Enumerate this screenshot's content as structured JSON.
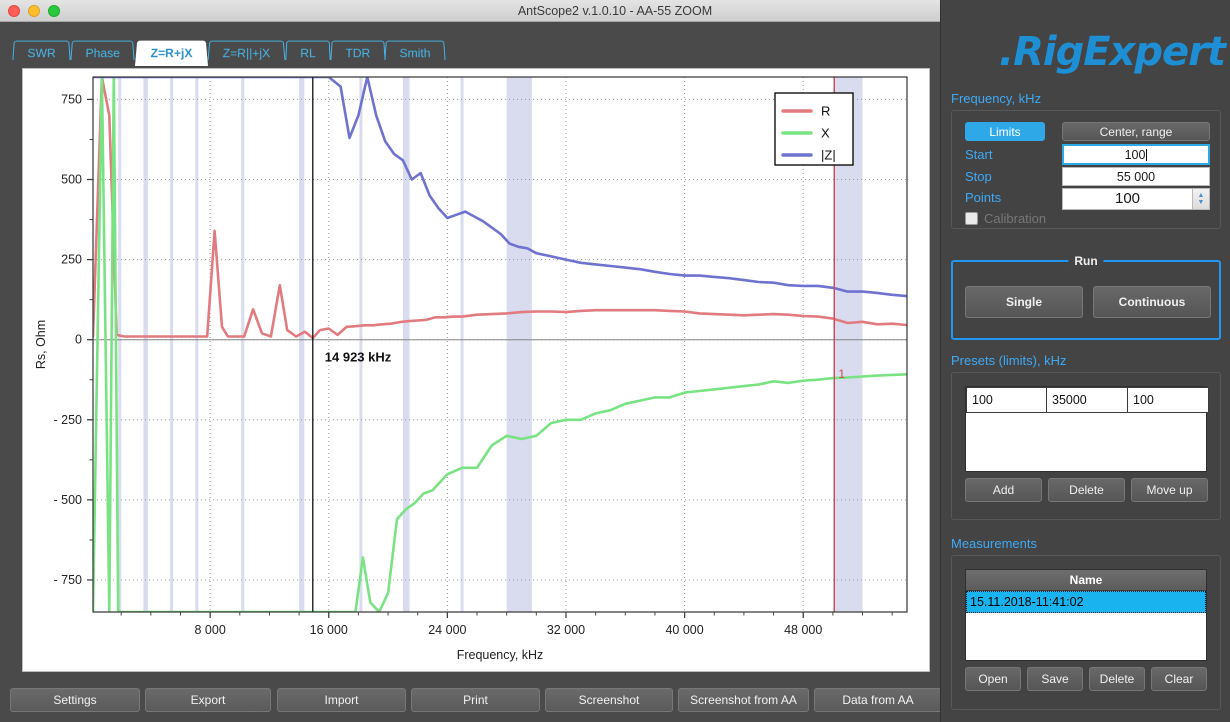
{
  "window": {
    "title": "AntScope2 v.1.0.10 - AA-55 ZOOM",
    "traffic_lights": [
      "close",
      "minimize",
      "zoom"
    ]
  },
  "tabs": [
    {
      "label": "SWR",
      "active": false
    },
    {
      "label": "Phase",
      "active": false
    },
    {
      "label": "Z=R+jX",
      "active": true
    },
    {
      "label": "Z=R||+jX",
      "active": false
    },
    {
      "label": "RL",
      "active": false
    },
    {
      "label": "TDR",
      "active": false
    },
    {
      "label": "Smith",
      "active": false
    }
  ],
  "bottom_toolbar": {
    "buttons": [
      {
        "label": "Settings",
        "x": 10,
        "w": 130
      },
      {
        "label": "Export",
        "x": 145,
        "w": 126
      },
      {
        "label": "Import",
        "x": 277,
        "w": 129
      },
      {
        "label": "Print",
        "x": 411,
        "w": 129
      },
      {
        "label": "Screenshot",
        "x": 545,
        "w": 128
      },
      {
        "label": "Screenshot from AA",
        "x": 678,
        "w": 131
      },
      {
        "label": "Data from AA",
        "x": 814,
        "w": 128
      }
    ]
  },
  "logo": {
    "text": ".RigExpert",
    "color": "#1e8fd5"
  },
  "right_panel": {
    "frequency": {
      "section_title": "Frequency, kHz",
      "mode_limits": "Limits",
      "mode_center_range": "Center, range",
      "start_label": "Start",
      "start_value": "100",
      "stop_label": "Stop",
      "stop_value": "55 000",
      "points_label": "Points",
      "points_value": "100",
      "calibration_label": "Calibration",
      "calibration_checked": false
    },
    "run": {
      "legend": "Run",
      "single": "Single",
      "continuous": "Continuous"
    },
    "presets": {
      "section_title": "Presets (limits), kHz",
      "rows": [
        [
          "100",
          "35000",
          "100"
        ]
      ],
      "buttons": [
        "Add",
        "Delete",
        "Move up"
      ]
    },
    "measurements": {
      "section_title": "Measurements",
      "column_header": "Name",
      "rows": [
        "15.11.2018-11:41:02"
      ],
      "selected_index": 0,
      "buttons": [
        "Open",
        "Save",
        "Delete",
        "Clear"
      ]
    }
  },
  "chart_data": {
    "type": "line",
    "title": "",
    "xlabel": "Frequency, kHz",
    "ylabel": "Rs, Ohm",
    "xlim": [
      100,
      55000
    ],
    "ylim": [
      -850,
      820
    ],
    "xticks": [
      8000,
      16000,
      24000,
      32000,
      40000,
      48000
    ],
    "xticklabels": [
      "8 000",
      "16 000",
      "24 000",
      "32 000",
      "40 000",
      "48 000"
    ],
    "yticks": [
      750,
      500,
      250,
      0,
      -250,
      -500,
      -750
    ],
    "yticklabels": [
      "750",
      "500",
      "250",
      "0",
      "- 250",
      "- 500",
      "- 750"
    ],
    "grid": true,
    "legend_position": "top-right",
    "legend": [
      {
        "name": "R",
        "color": "#e27b7f"
      },
      {
        "name": "X",
        "color": "#79e383"
      },
      {
        "name": "|Z|",
        "color": "#6f72cf"
      }
    ],
    "cursor": {
      "label": "14 923 kHz",
      "freq": 14923
    },
    "marker": {
      "label": "1",
      "freq": 50100,
      "color": "#d04a52"
    },
    "ham_bands": [
      [
        1800,
        2000
      ],
      [
        3500,
        3800
      ],
      [
        5300,
        5410
      ],
      [
        7000,
        7200
      ],
      [
        10100,
        10150
      ],
      [
        14000,
        14350
      ],
      [
        18068,
        18168
      ],
      [
        21000,
        21450
      ],
      [
        24890,
        24990
      ],
      [
        28000,
        29700
      ],
      [
        50000,
        52000
      ]
    ],
    "series": [
      {
        "name": "R",
        "color": "#e27b7f",
        "x": [
          100,
          700,
          1200,
          1700,
          2200,
          2700,
          3200,
          3700,
          4200,
          4800,
          5400,
          6000,
          6600,
          7200,
          7800,
          8300,
          8800,
          9200,
          9700,
          10300,
          10900,
          11500,
          12100,
          12700,
          13200,
          13800,
          14400,
          14923,
          15400,
          16000,
          16600,
          17200,
          17800,
          18400,
          19000,
          19600,
          20200,
          20800,
          21400,
          22000,
          22600,
          23200,
          23800,
          24400,
          25000,
          26000,
          27000,
          28000,
          29000,
          30000,
          31000,
          32000,
          33000,
          34000,
          35000,
          36000,
          37000,
          38000,
          39000,
          40000,
          41000,
          42000,
          43000,
          44000,
          45000,
          46000,
          47000,
          48000,
          49000,
          50000,
          51000,
          52000,
          53000,
          54000,
          55000
        ],
        "y": [
          10,
          820,
          700,
          15,
          10,
          10,
          10,
          10,
          10,
          10,
          10,
          10,
          10,
          10,
          10,
          340,
          40,
          10,
          10,
          10,
          95,
          20,
          10,
          170,
          30,
          10,
          25,
          5,
          30,
          35,
          15,
          40,
          42,
          45,
          45,
          48,
          50,
          55,
          58,
          60,
          62,
          70,
          70,
          72,
          72,
          78,
          80,
          82,
          86,
          88,
          88,
          86,
          90,
          92,
          92,
          92,
          92,
          92,
          90,
          88,
          82,
          80,
          78,
          76,
          78,
          80,
          78,
          74,
          72,
          66,
          52,
          56,
          48,
          50,
          46
        ]
      },
      {
        "name": "X",
        "color": "#79e383",
        "x": [
          100,
          700,
          1200,
          1500,
          1800,
          2100,
          2600,
          3200,
          3800,
          4400,
          5000,
          6000,
          7000,
          8000,
          9000,
          10000,
          11000,
          12000,
          13000,
          14000,
          15000,
          16000,
          17000,
          17800,
          18300,
          18800,
          19400,
          20000,
          20600,
          21200,
          21800,
          22400,
          23000,
          24000,
          25000,
          26000,
          27000,
          28000,
          29000,
          30000,
          31000,
          32000,
          33000,
          34000,
          35000,
          36000,
          37000,
          38000,
          39000,
          40000,
          41000,
          42000,
          43000,
          44000,
          45000,
          46000,
          47000,
          48000,
          49000,
          50000,
          51000,
          52000,
          53000,
          54000,
          55000
        ],
        "y": [
          -850,
          820,
          -850,
          820,
          -850,
          -850,
          -850,
          -850,
          -850,
          -850,
          -850,
          -850,
          -850,
          -850,
          -850,
          -850,
          -850,
          -850,
          -850,
          -850,
          -850,
          -850,
          -850,
          -850,
          -680,
          -820,
          -850,
          -790,
          -560,
          -530,
          -510,
          -480,
          -470,
          -420,
          -400,
          -400,
          -330,
          -300,
          -310,
          -300,
          -260,
          -250,
          -250,
          -230,
          -220,
          -200,
          -190,
          -180,
          -180,
          -165,
          -160,
          -155,
          -150,
          -145,
          -140,
          -130,
          -135,
          -128,
          -125,
          -120,
          -118,
          -115,
          -112,
          -110,
          -108
        ]
      },
      {
        "name": "|Z|",
        "color": "#6f72cf",
        "x": [
          100,
          1000,
          2000,
          4000,
          6000,
          8000,
          10000,
          12000,
          14000,
          15000,
          16000,
          16800,
          17400,
          18000,
          18600,
          19200,
          19800,
          20400,
          21000,
          21600,
          22200,
          22800,
          23400,
          24000,
          24600,
          25200,
          25800,
          26400,
          27000,
          27600,
          28200,
          28800,
          29400,
          30000,
          31000,
          32000,
          33000,
          34000,
          35000,
          36000,
          37000,
          38000,
          39000,
          40000,
          41000,
          42000,
          43000,
          44000,
          45000,
          46000,
          47000,
          48000,
          49000,
          50000,
          51000,
          52000,
          53000,
          54000,
          55000
        ],
        "y": [
          820,
          820,
          820,
          820,
          820,
          820,
          820,
          820,
          820,
          820,
          820,
          790,
          630,
          700,
          820,
          700,
          620,
          580,
          560,
          500,
          520,
          450,
          410,
          380,
          390,
          400,
          385,
          370,
          350,
          330,
          300,
          290,
          285,
          270,
          260,
          250,
          240,
          235,
          230,
          225,
          220,
          212,
          205,
          200,
          200,
          196,
          192,
          186,
          180,
          178,
          170,
          168,
          168,
          162,
          150,
          150,
          146,
          140,
          136
        ]
      }
    ]
  }
}
